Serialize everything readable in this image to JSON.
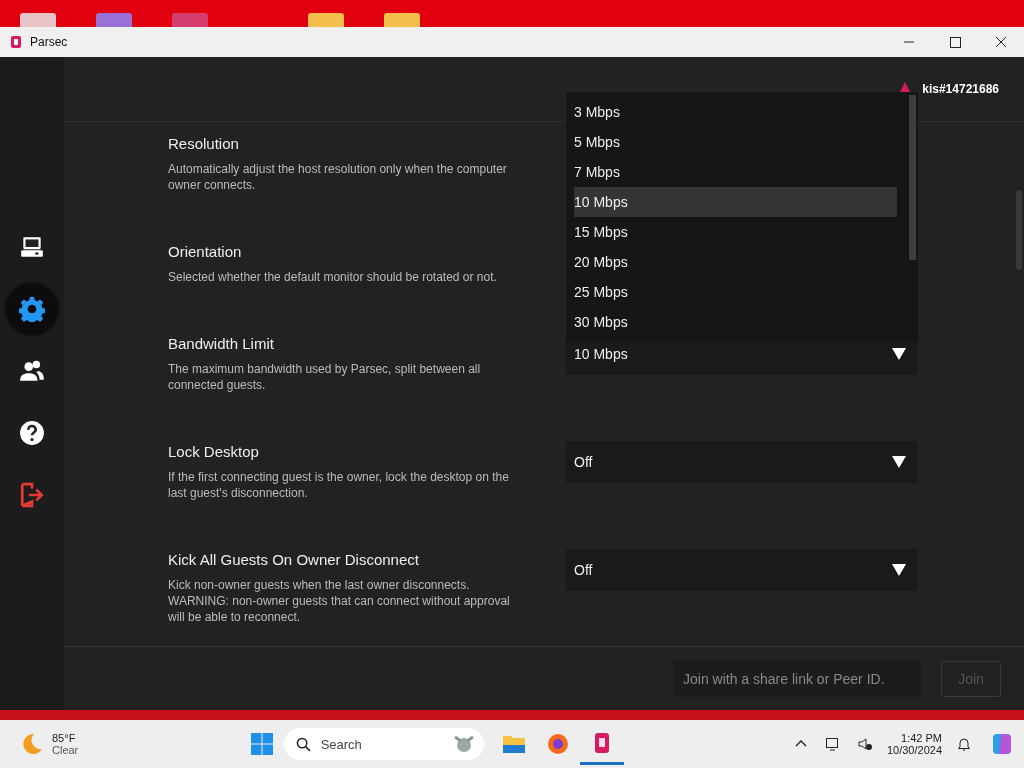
{
  "window": {
    "title": "Parsec"
  },
  "sidebar": {
    "items": [
      {
        "kind": "computer",
        "selected": false
      },
      {
        "kind": "settings",
        "selected": true
      },
      {
        "kind": "friends",
        "selected": false
      },
      {
        "kind": "help",
        "selected": false
      },
      {
        "kind": "logout",
        "selected": false
      }
    ]
  },
  "header": {
    "username": "kis#14721686"
  },
  "settings": [
    {
      "title": "Resolution",
      "description": "Automatically adjust the host resolution only when the computer owner connects."
    },
    {
      "title": "Orientation",
      "description": "Selected whether the default monitor should be rotated or not."
    },
    {
      "title": "Bandwidth Limit",
      "description": "The maximum bandwidth used by Parsec, split between all connected guests.",
      "dropdown": {
        "value": "10 Mbps"
      }
    },
    {
      "title": "Lock Desktop",
      "description": "If the first connecting guest is the owner, lock the desktop on the last guest's disconnection.",
      "dropdown": {
        "value": "Off"
      }
    },
    {
      "title": "Kick All Guests On Owner Disconnect",
      "description": "Kick non-owner guests when the last owner disconnects. WARNING: non-owner guests that can connect without approval will be able to reconnect.",
      "dropdown": {
        "value": "Off"
      }
    }
  ],
  "open_list": {
    "options": [
      {
        "label": "3 Mbps",
        "selected": false
      },
      {
        "label": "5 Mbps",
        "selected": false
      },
      {
        "label": "7 Mbps",
        "selected": false
      },
      {
        "label": "10 Mbps",
        "selected": true
      },
      {
        "label": "15 Mbps",
        "selected": false
      },
      {
        "label": "20 Mbps",
        "selected": false
      },
      {
        "label": "25 Mbps",
        "selected": false
      },
      {
        "label": "30 Mbps",
        "selected": false
      }
    ]
  },
  "footer": {
    "join_field": {
      "placeholder": "Join with a share link or Peer ID."
    },
    "join_button": {
      "label": "Join",
      "disabled": true
    }
  },
  "taskbar": {
    "weather": {
      "temperature": "85°F",
      "condition": "Clear"
    },
    "search": {
      "placeholder": "Search"
    },
    "clock": {
      "time": "1:42 PM",
      "date": "10/30/2024"
    }
  }
}
